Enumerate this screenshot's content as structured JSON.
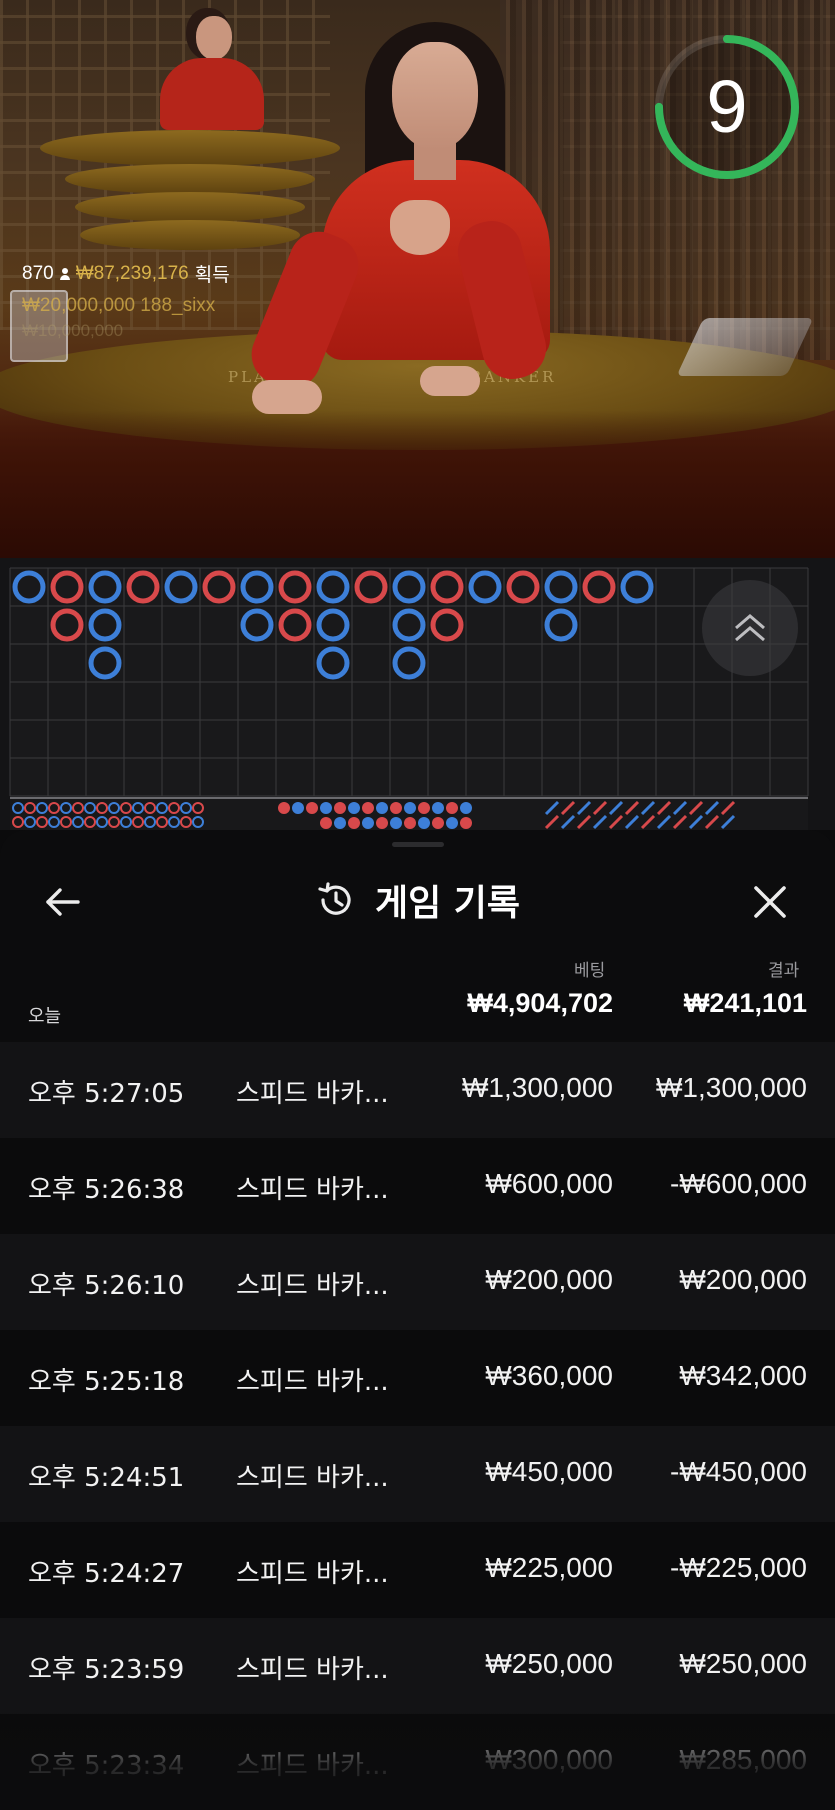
{
  "video": {
    "timer": "9",
    "winners": {
      "count": "870",
      "amount": "₩87,239,176",
      "label": "획득",
      "top_winner": "₩20,000,000  188_sixx",
      "next_winner": "₩10,000,000"
    },
    "table_labels": {
      "player": "PLAYER",
      "banker": "BANKER"
    },
    "timer_progress": 0.75,
    "colors": {
      "timer_ring": "#34b65a",
      "player_blue": "#3d7fd8",
      "banker_red": "#d8494b"
    }
  },
  "roadmap": {
    "big_road": [
      [
        "P",
        "B",
        "P",
        "B",
        "P",
        "B",
        "P",
        "B",
        "P",
        "B",
        "P",
        "B",
        "P",
        "B",
        "P",
        "B",
        "P"
      ],
      [
        null,
        "B",
        "P",
        null,
        null,
        null,
        "P",
        "B",
        "P",
        null,
        "P",
        "B",
        null,
        null,
        "P",
        null,
        null
      ],
      [
        null,
        null,
        "P",
        null,
        null,
        null,
        null,
        null,
        "P",
        null,
        "P",
        null,
        null,
        null,
        null,
        null,
        null
      ]
    ],
    "scroll_button_icon": "double-chevron-up-icon"
  },
  "history": {
    "back_icon": "arrow-left-icon",
    "title_icon": "history-clock-icon",
    "title": "게임 기록",
    "close_icon": "close-icon",
    "columns": {
      "bet": "베팅",
      "result": "결과"
    },
    "today": {
      "label": "오늘",
      "bet": "₩4,904,702",
      "result": "₩241,101"
    },
    "rows": [
      {
        "time": "오후 5:27:05",
        "game": "스피드 바카...",
        "bet": "₩1,300,000",
        "result": "₩1,300,000"
      },
      {
        "time": "오후 5:26:38",
        "game": "스피드 바카...",
        "bet": "₩600,000",
        "result": "-₩600,000"
      },
      {
        "time": "오후 5:26:10",
        "game": "스피드 바카...",
        "bet": "₩200,000",
        "result": "₩200,000"
      },
      {
        "time": "오후 5:25:18",
        "game": "스피드 바카...",
        "bet": "₩360,000",
        "result": "₩342,000"
      },
      {
        "time": "오후 5:24:51",
        "game": "스피드 바카...",
        "bet": "₩450,000",
        "result": "-₩450,000"
      },
      {
        "time": "오후 5:24:27",
        "game": "스피드 바카...",
        "bet": "₩225,000",
        "result": "-₩225,000"
      },
      {
        "time": "오후 5:23:59",
        "game": "스피드 바카...",
        "bet": "₩250,000",
        "result": "₩250,000"
      },
      {
        "time": "오후 5:23:34",
        "game": "스피드 바카...",
        "bet": "₩300,000",
        "result": "₩285,000"
      }
    ]
  }
}
